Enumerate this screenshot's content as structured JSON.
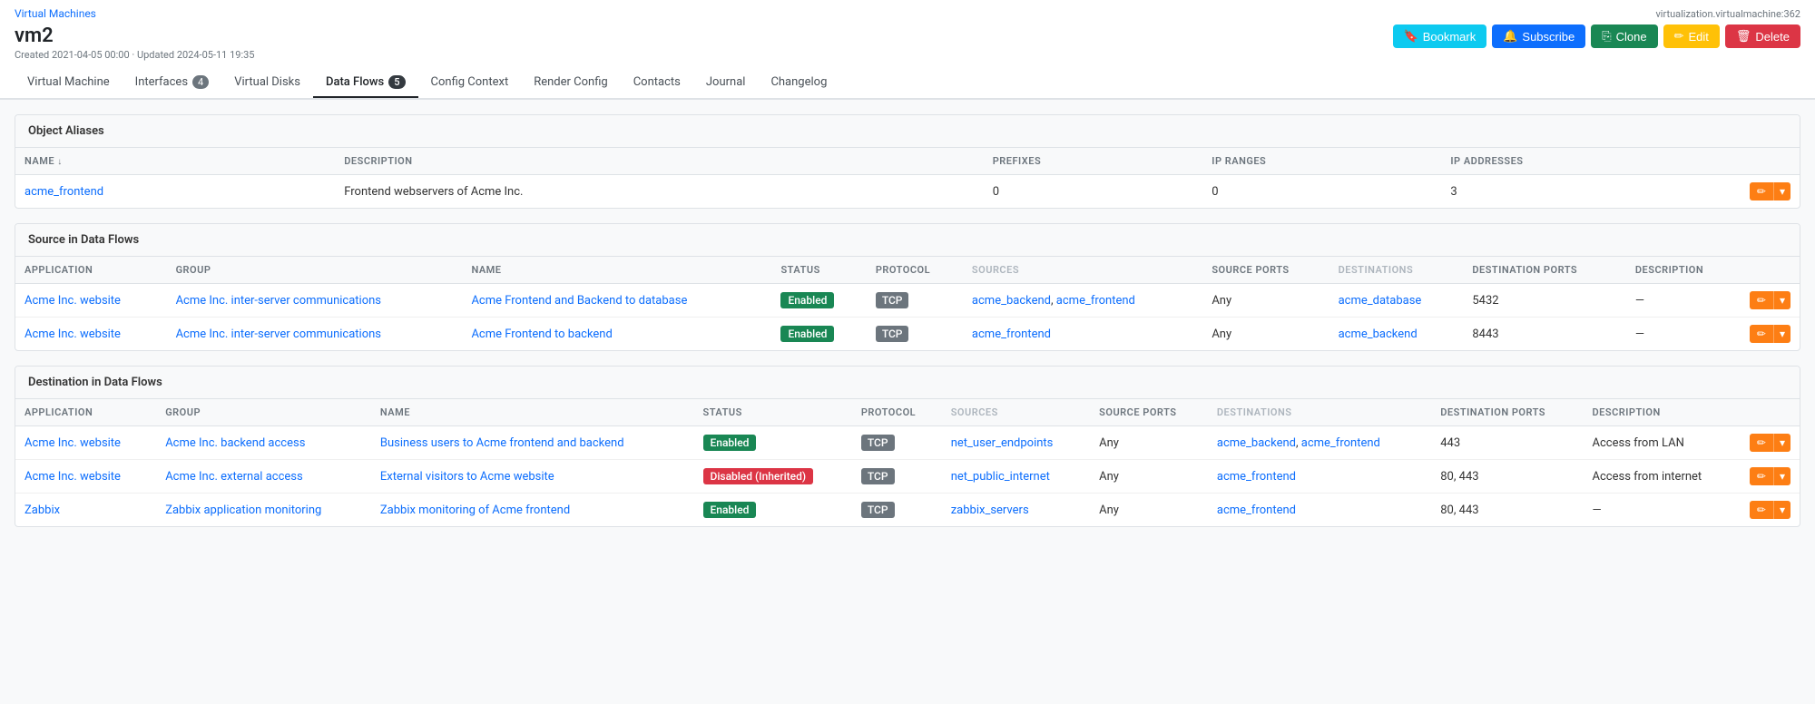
{
  "page": {
    "breadcrumb": "Virtual Machines",
    "top_right_label": "virtualization.virtualmachine:362",
    "vm_title": "vm2",
    "vm_meta": "Created 2021-04-05 00:00 · Updated 2024-05-11 19:35"
  },
  "actions": {
    "bookmark": "Bookmark",
    "subscribe": "Subscribe",
    "clone": "Clone",
    "edit": "Edit",
    "delete": "Delete"
  },
  "tabs": [
    {
      "label": "Virtual Machine",
      "badge": null,
      "active": false
    },
    {
      "label": "Interfaces",
      "badge": "4",
      "active": false
    },
    {
      "label": "Virtual Disks",
      "badge": null,
      "active": false
    },
    {
      "label": "Data Flows",
      "badge": "5",
      "active": true
    },
    {
      "label": "Config Context",
      "badge": null,
      "active": false
    },
    {
      "label": "Render Config",
      "badge": null,
      "active": false
    },
    {
      "label": "Contacts",
      "badge": null,
      "active": false
    },
    {
      "label": "Journal",
      "badge": null,
      "active": false
    },
    {
      "label": "Changelog",
      "badge": null,
      "active": false
    }
  ],
  "object_aliases": {
    "section_title": "Object Aliases",
    "columns": [
      "NAME",
      "DESCRIPTION",
      "PREFIXES",
      "IP RANGES",
      "IP ADDRESSES"
    ],
    "rows": [
      {
        "name": "acme_frontend",
        "description": "Frontend webservers of Acme Inc.",
        "prefixes": "0",
        "ip_ranges": "0",
        "ip_addresses": "3"
      }
    ]
  },
  "source_flows": {
    "section_title": "Source in Data Flows",
    "columns": [
      "APPLICATION",
      "GROUP",
      "NAME",
      "STATUS",
      "PROTOCOL",
      "SOURCES",
      "SOURCE PORTS",
      "DESTINATIONS",
      "DESTINATION PORTS",
      "DESCRIPTION"
    ],
    "rows": [
      {
        "application": "Acme Inc. website",
        "group": "Acme Inc. inter-server communications",
        "name": "Acme Frontend and Backend to database",
        "status": "Enabled",
        "status_type": "enabled",
        "protocol": "TCP",
        "sources": [
          "acme_backend",
          "acme_frontend"
        ],
        "source_ports": "Any",
        "destinations": "acme_database",
        "destination_ports": "5432",
        "description": "—"
      },
      {
        "application": "Acme Inc. website",
        "group": "Acme Inc. inter-server communications",
        "name": "Acme Frontend to backend",
        "status": "Enabled",
        "status_type": "enabled",
        "protocol": "TCP",
        "sources": [
          "acme_frontend"
        ],
        "source_ports": "Any",
        "destinations": "acme_backend",
        "destination_ports": "8443",
        "description": "—"
      }
    ]
  },
  "destination_flows": {
    "section_title": "Destination in Data Flows",
    "columns": [
      "APPLICATION",
      "GROUP",
      "NAME",
      "STATUS",
      "PROTOCOL",
      "SOURCES",
      "SOURCE PORTS",
      "DESTINATIONS",
      "DESTINATION PORTS",
      "DESCRIPTION"
    ],
    "rows": [
      {
        "application": "Acme Inc. website",
        "group": "Acme Inc. backend access",
        "name": "Business users to Acme frontend and backend",
        "status": "Enabled",
        "status_type": "enabled",
        "protocol": "TCP",
        "sources": "net_user_endpoints",
        "source_ports": "Any",
        "destinations": [
          "acme_backend",
          "acme_frontend"
        ],
        "destination_ports": "443",
        "description": "Access from LAN"
      },
      {
        "application": "Acme Inc. website",
        "group": "Acme Inc. external access",
        "name": "External visitors to Acme website",
        "status": "Disabled (Inherited)",
        "status_type": "disabled",
        "protocol": "TCP",
        "sources": "net_public_internet",
        "source_ports": "Any",
        "destinations": [
          "acme_frontend"
        ],
        "destination_ports": "80, 443",
        "description": "Access from internet"
      },
      {
        "application": "Zabbix",
        "group": "Zabbix application monitoring",
        "name": "Zabbix monitoring of Acme frontend",
        "status": "Enabled",
        "status_type": "enabled",
        "protocol": "TCP",
        "sources": "zabbix_servers",
        "source_ports": "Any",
        "destinations": [
          "acme_frontend"
        ],
        "destination_ports": "80, 443",
        "description": "—"
      }
    ]
  }
}
